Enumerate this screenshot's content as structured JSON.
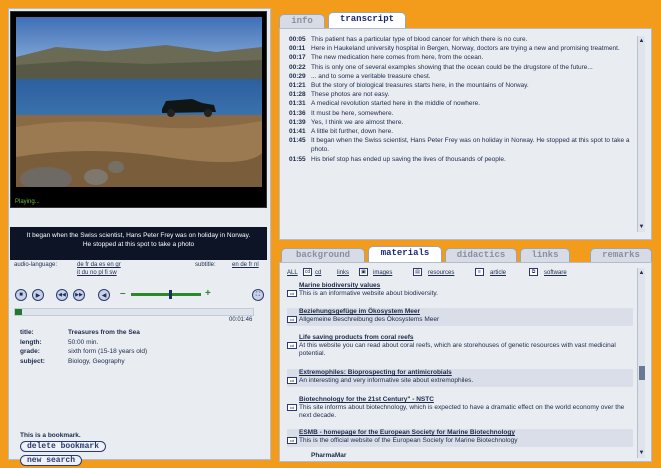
{
  "video": {
    "status": "Playing...",
    "caption": "It began when the Swiss scientist, Hans Peter Frey was on holiday in Norway. He stopped at this spot to take a photo",
    "progress_fraction": 0.03,
    "time": "00:01:46"
  },
  "audio": {
    "label": "audio-language:",
    "langs_line1": "de fr da es en gr",
    "langs_line2": "it du no pl fi sw"
  },
  "subtitle": {
    "label": "subtitle:",
    "langs": "en de fr nl"
  },
  "controls": {
    "stop": "■",
    "play": "▶",
    "rewind": "◀◀",
    "forward": "▶▶",
    "speaker": "◀",
    "minus": "–",
    "plus": "+",
    "fullscreen": "⛶"
  },
  "meta": [
    {
      "key": "title:",
      "value": "Treasures from the Sea"
    },
    {
      "key": "length:",
      "value": "50:00 min."
    },
    {
      "key": "grade:",
      "value": "sixth form (15-18 years old)"
    },
    {
      "key": "subject:",
      "value": "Biology, Geography"
    }
  ],
  "bookmark": {
    "text": "This is a bookmark.",
    "delete_label": "delete bookmark",
    "search_label": "new search"
  },
  "top_tabs": {
    "info": "info",
    "transcript": "transcript"
  },
  "transcript": [
    {
      "t": "00:05",
      "text": "This patient has a particular type of blood cancer for which there is no cure."
    },
    {
      "t": "00:11",
      "text": "Here in Haukeland university hospital in Bergen, Norway, doctors are trying a new and promising treatment."
    },
    {
      "t": "00:17",
      "text": "The new medication here comes from here, from the ocean."
    },
    {
      "t": "00:22",
      "text": "This is only one of several examples showing that the ocean could be the drugstore of the future..."
    },
    {
      "t": "00:29",
      "text": "... and to some a veritable treasure chest."
    },
    {
      "t": "01:21",
      "text": "But the story of biological treasures starts here, in the mountains of Norway."
    },
    {
      "t": "01:28",
      "text": "These photos are not easy."
    },
    {
      "t": "01:31",
      "text": "A medical revolution started here in the middle of nowhere."
    },
    {
      "t": "01:36",
      "text": "It must be here, somewhere."
    },
    {
      "t": "01:39",
      "text": "Yes, I think we are almost there."
    },
    {
      "t": "01:41",
      "text": "A little bit further, down here."
    },
    {
      "t": "01:45",
      "text": "It began when the Swiss scientist, Hans Peter Frey was on holiday in Norway. He stopped at this spot to take a photo."
    },
    {
      "t": "01:55",
      "text": "His brief stop has ended up saving the lives of thousands of people."
    }
  ],
  "bottom_tabs": {
    "background": "background",
    "materials": "materials",
    "didactics": "didactics",
    "links": "links",
    "remarks": "remarks"
  },
  "material_filters": {
    "all": "ALL",
    "cd": "cd",
    "links": "links",
    "images": "images",
    "resources": "resources",
    "article": "article",
    "software": "software"
  },
  "materials": [
    {
      "title": "Marine biodiversity values",
      "desc": "This is an informative website about biodiversity."
    },
    {
      "title": "Beziehungsgefüge im Ökosystem Meer",
      "desc": "Allgemeine Beschreibung des Ökosystems Meer"
    },
    {
      "title": "Life saving products from coral reefs",
      "desc": "At this website you can read about coral reefs, which are storehouses of genetic resources with vast medicinal potential."
    },
    {
      "title": "Extremophiles: Bioprospecting for antimicrobials",
      "desc": "An interesting and very informative site about extremophiles."
    },
    {
      "title": "Biotechnology for the 21st Century\" - NSTC",
      "desc": "This site informs about biotechnology, which is expected to have a dramatic effect on the world economy over the next decade."
    },
    {
      "title": "ESMB - homepage for the European Society for Marine Biotechnology",
      "desc": "This is the official website of the European Society for Marine Biotechnology"
    },
    {
      "title": "PharmaMar",
      "desc": ""
    }
  ],
  "colors": {
    "background": "#f39c1c",
    "panel": "#e9edf2",
    "accent": "#1c2a70",
    "caption_bg": "#0d1426",
    "progress": "#1e7a2e"
  }
}
